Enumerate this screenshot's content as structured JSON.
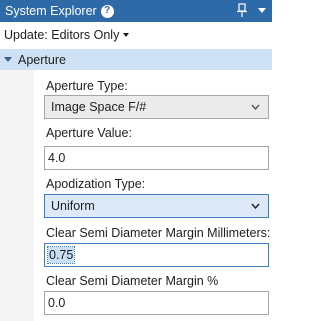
{
  "titlebar": {
    "title": "System Explorer",
    "help_icon": "question-circle-icon",
    "help_glyph": "?",
    "pin_icon": "pin-icon",
    "dock_icon": "dock-arrow-icon"
  },
  "toolbar": {
    "update_label": "Update: Editors Only"
  },
  "section": {
    "title": "Aperture",
    "expanded": true
  },
  "fields": {
    "aperture_type": {
      "label": "Aperture Type:",
      "value": "Image Space F/#"
    },
    "aperture_value": {
      "label": "Aperture Value:",
      "value": "4.0"
    },
    "apodization_type": {
      "label": "Apodization Type:",
      "value": "Uniform"
    },
    "clear_semi_diameter_margin_mm": {
      "label": "Clear Semi Diameter Margin Millimeters:",
      "value": "0.75"
    },
    "clear_semi_diameter_margin_pct": {
      "label": "Clear Semi Diameter Margin %",
      "value": "0.0"
    }
  },
  "colors": {
    "titlebar": "#2e69a8",
    "section_header": "#cfe2f5",
    "active_combo": "#dde9f8",
    "focus_border": "#3d7fc1"
  }
}
